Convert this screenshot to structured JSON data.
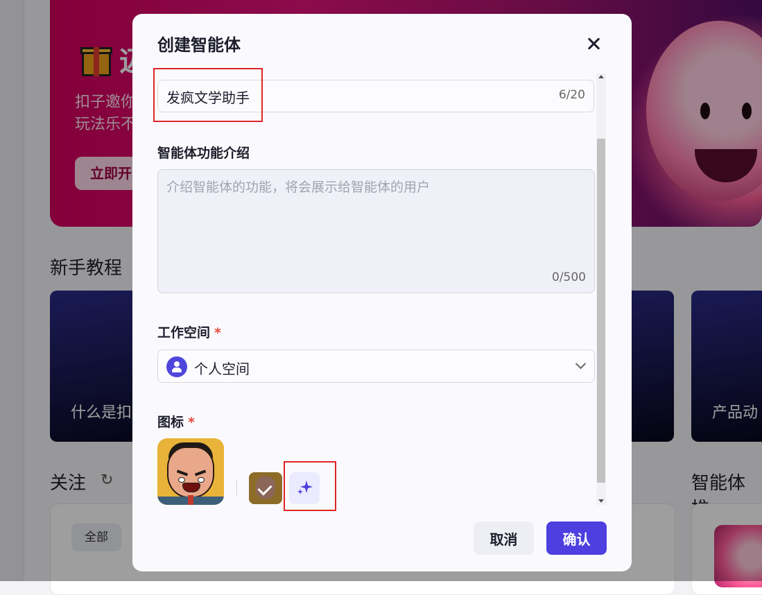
{
  "background": {
    "banner_title": "迈",
    "banner_sub_1": "扣子邀你",
    "banner_sub_2": "玩法乐不",
    "banner_button": "立即开",
    "tutorial_title": "新手教程",
    "card_left_text": "什么是扣",
    "card_right_text": "产品动",
    "follow_title": "关注",
    "follow_chip": "全部",
    "agents_title": "智能体推"
  },
  "modal": {
    "title": "创建智能体",
    "name": {
      "value": "发疯文学助手",
      "count": "6/20"
    },
    "description": {
      "label": "智能体功能介绍",
      "placeholder": "介绍智能体的功能，将会展示给智能体的用户",
      "count": "0/500"
    },
    "workspace": {
      "label": "工作空间",
      "required_mark": "*",
      "selected": "个人空间"
    },
    "icon": {
      "label": "图标",
      "required_mark": "*"
    },
    "cancel_label": "取消",
    "confirm_label": "确认"
  },
  "colors": {
    "accent": "#4d3fe0",
    "required": "#e5483b",
    "annotation": "#e02424"
  }
}
